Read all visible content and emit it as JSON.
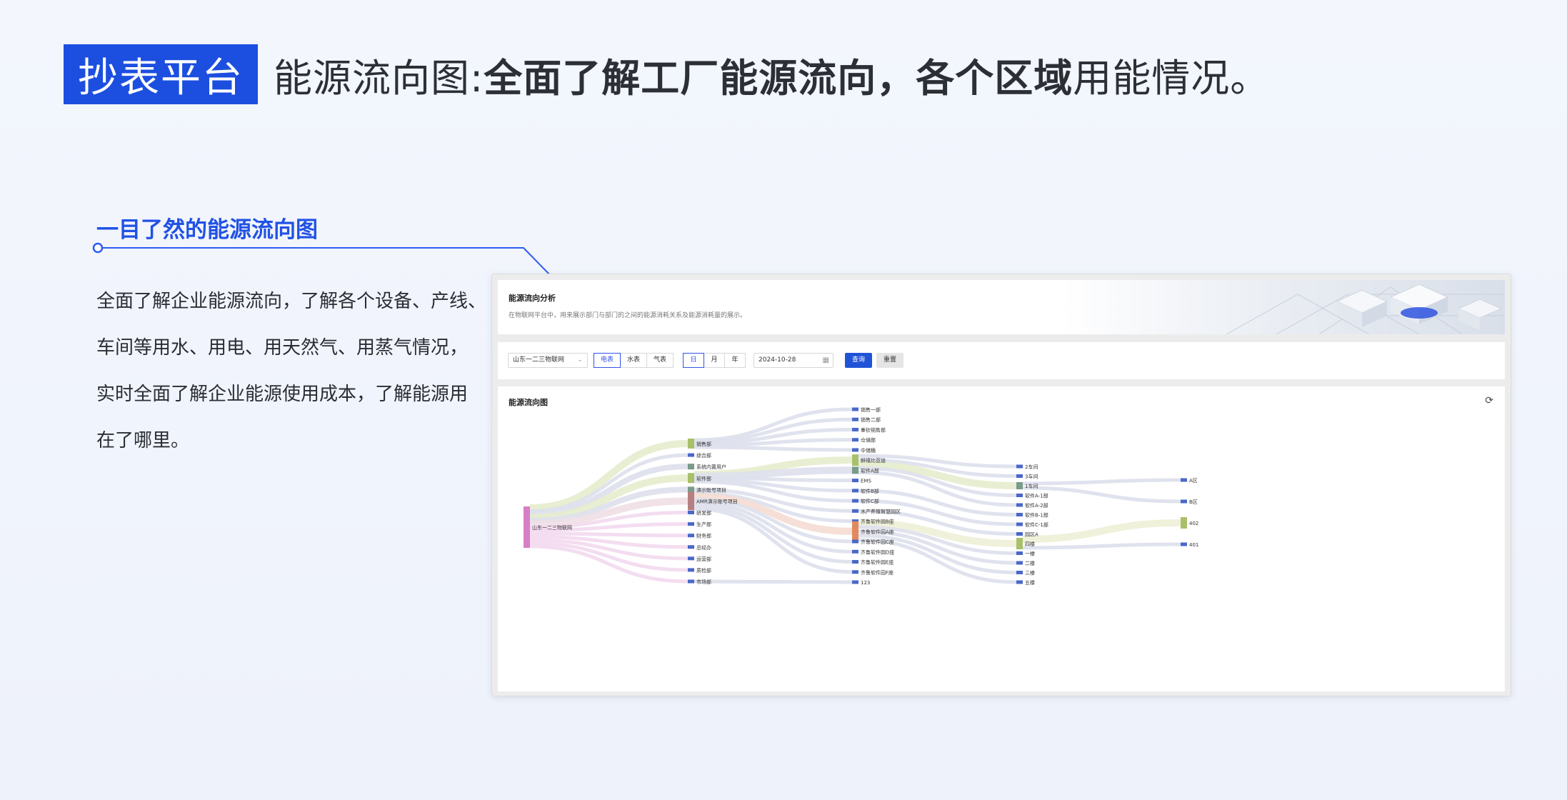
{
  "headline": {
    "badge": "抄表平台",
    "prefix": "能源流向图:",
    "bold": "全面了解工厂能源流向，各个区域",
    "suffix": "用能情况。"
  },
  "feature": {
    "title": "一目了然的能源流向图",
    "description": "全面了解企业能源流向，了解各个设备、产线、\n车间等用水、用电、用天然气、用蒸气情况，\n实时全面了解企业能源使用成本，了解能源用\n在了哪里。"
  },
  "app": {
    "header": {
      "title": "能源流向分析",
      "subtitle": "在物联网平台中，用来展示部门与部门的之间的能源消耗关系及能源消耗量的展示。"
    },
    "filters": {
      "site_select": "山东一二三物联网",
      "energy_types": [
        "电表",
        "水表",
        "气表"
      ],
      "energy_active": 0,
      "periods": [
        "日",
        "月",
        "年"
      ],
      "period_active": 0,
      "date": "2024-10-28",
      "query_label": "查询",
      "reset_label": "重置"
    },
    "chart_title": "能源流向图"
  },
  "colors": {
    "brand_blue": "#1c4fe0",
    "link": "#dde0ec",
    "node_default": "#4a67c9"
  },
  "chart_data": {
    "type": "sankey",
    "columns": [
      [
        {
          "name": "山东一二三物联网",
          "color": "#d77fc6",
          "size": 58
        }
      ],
      [
        {
          "name": "销售部",
          "color": "#a9c06a",
          "size": 14
        },
        {
          "name": "综合部"
        },
        {
          "name": "系统内置用户",
          "color": "#7a9a8a",
          "size": 8
        },
        {
          "name": "软件部",
          "color": "#a9c06a",
          "size": 14
        },
        {
          "name": "演示账号项目",
          "color": "#7a9a8a",
          "size": 8
        },
        {
          "name": "AMR演示账号项目",
          "color": "#b78080",
          "size": 26
        },
        {
          "name": "研发部"
        },
        {
          "name": "生产部"
        },
        {
          "name": "财务部"
        },
        {
          "name": "总经办"
        },
        {
          "name": "运营部"
        },
        {
          "name": "质检部"
        },
        {
          "name": "市场部"
        }
      ],
      [
        {
          "name": "销售一部"
        },
        {
          "name": "销售二部"
        },
        {
          "name": "重钦销售部"
        },
        {
          "name": "仓储部"
        },
        {
          "name": "中储桶"
        },
        {
          "name": "鲜禧比亚迪",
          "color": "#a9c06a",
          "size": 16
        },
        {
          "name": "软件A部",
          "color": "#7a9a8a",
          "size": 10
        },
        {
          "name": "EMS"
        },
        {
          "name": "软件B部"
        },
        {
          "name": "软件C部"
        },
        {
          "name": "水产养殖智慧园区"
        },
        {
          "name": "齐鲁软件园B座"
        },
        {
          "name": "齐鲁软件园A座",
          "color": "#e2895d",
          "size": 28
        },
        {
          "name": "齐鲁软件园C座"
        },
        {
          "name": "齐鲁软件园D座"
        },
        {
          "name": "齐鲁软件园E座"
        },
        {
          "name": "齐鲁软件园F座"
        },
        {
          "name": "123"
        }
      ],
      [
        {
          "name": "2车间"
        },
        {
          "name": "3车间"
        },
        {
          "name": "1车间",
          "color": "#7a9a8a",
          "size": 10
        },
        {
          "name": "软件A-1部"
        },
        {
          "name": "软件A-2部"
        },
        {
          "name": "软件B-1部"
        },
        {
          "name": "软件C-1部"
        },
        {
          "name": "园区A"
        },
        {
          "name": "四楼",
          "color": "#a9c06a",
          "size": 16
        },
        {
          "name": "一楼"
        },
        {
          "name": "二楼"
        },
        {
          "name": "三楼"
        },
        {
          "name": "五楼"
        }
      ],
      [
        {
          "name": "A区"
        },
        {
          "name": "B区"
        },
        {
          "name": "402",
          "color": "#a9c06a",
          "size": 16
        },
        {
          "name": "401"
        }
      ]
    ],
    "links": [
      [
        "山东一二三物联网",
        "销售部",
        "#e6eccc"
      ],
      [
        "山东一二三物联网",
        "综合部"
      ],
      [
        "山东一二三物联网",
        "系统内置用户"
      ],
      [
        "山东一二三物联网",
        "软件部",
        "#e6eccc"
      ],
      [
        "山东一二三物联网",
        "演示账号项目"
      ],
      [
        "山东一二三物联网",
        "AMR演示账号项目",
        "#f0dfe6"
      ],
      [
        "山东一二三物联网",
        "研发部",
        "#f3d9ee"
      ],
      [
        "山东一二三物联网",
        "生产部",
        "#f3d9ee"
      ],
      [
        "山东一二三物联网",
        "财务部",
        "#f3d9ee"
      ],
      [
        "山东一二三物联网",
        "总经办",
        "#f3d9ee"
      ],
      [
        "山东一二三物联网",
        "运营部",
        "#f3d9ee"
      ],
      [
        "山东一二三物联网",
        "质检部",
        "#f3d9ee"
      ],
      [
        "山东一二三物联网",
        "市场部",
        "#f3d9ee"
      ],
      [
        "销售部",
        "销售一部"
      ],
      [
        "销售部",
        "销售二部"
      ],
      [
        "销售部",
        "重钦销售部"
      ],
      [
        "销售部",
        "仓储部"
      ],
      [
        "销售部",
        "中储桶"
      ],
      [
        "软件部",
        "鲜禧比亚迪",
        "#e6eccc"
      ],
      [
        "软件部",
        "软件A部"
      ],
      [
        "软件部",
        "EMS"
      ],
      [
        "软件部",
        "软件B部"
      ],
      [
        "软件部",
        "软件C部"
      ],
      [
        "演示账号项目",
        "水产养殖智慧园区"
      ],
      [
        "AMR演示账号项目",
        "齐鲁软件园B座"
      ],
      [
        "AMR演示账号项目",
        "齐鲁软件园A座",
        "#f4dcd3"
      ],
      [
        "AMR演示账号项目",
        "齐鲁软件园C座"
      ],
      [
        "AMR演示账号项目",
        "齐鲁软件园D座"
      ],
      [
        "AMR演示账号项目",
        "齐鲁软件园E座"
      ],
      [
        "AMR演示账号项目",
        "齐鲁软件园F座"
      ],
      [
        "市场部",
        "123"
      ],
      [
        "鲜禧比亚迪",
        "2车间"
      ],
      [
        "鲜禧比亚迪",
        "3车间"
      ],
      [
        "鲜禧比亚迪",
        "1车间",
        "#e6eccc"
      ],
      [
        "软件A部",
        "软件A-1部"
      ],
      [
        "软件A部",
        "软件A-2部"
      ],
      [
        "软件B部",
        "软件B-1部"
      ],
      [
        "软件C部",
        "软件C-1部"
      ],
      [
        "水产养殖智慧园区",
        "园区A"
      ],
      [
        "齐鲁软件园A座",
        "四楼",
        "#eef0d6"
      ],
      [
        "齐鲁软件园A座",
        "一楼"
      ],
      [
        "齐鲁软件园A座",
        "二楼"
      ],
      [
        "齐鲁软件园A座",
        "三楼"
      ],
      [
        "齐鲁软件园A座",
        "五楼"
      ],
      [
        "1车间",
        "A区"
      ],
      [
        "1车间",
        "B区"
      ],
      [
        "四楼",
        "402",
        "#eef0d6"
      ],
      [
        "四楼",
        "401"
      ]
    ]
  }
}
